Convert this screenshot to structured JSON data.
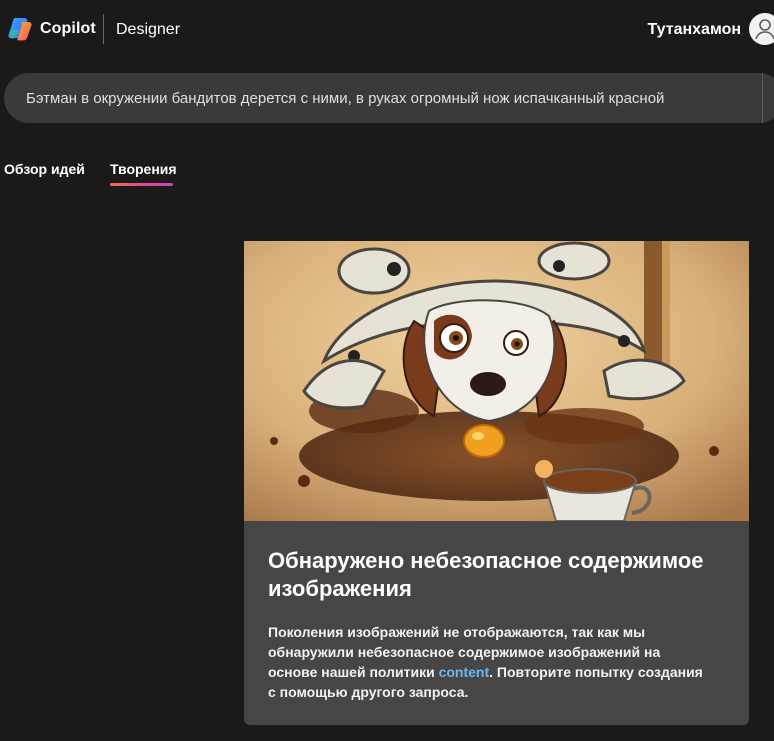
{
  "header": {
    "brand": "Copilot",
    "product": "Designer",
    "username": "Тутанхамон",
    "logo_icon": "copilot-logo-icon",
    "avatar_icon": "user-avatar-icon"
  },
  "prompt": {
    "text": "Бэтман в окружении бандитов дерется с ними, в руках огромный нож испачканный красной"
  },
  "tabs": [
    {
      "label": "Обзор идей",
      "active": false
    },
    {
      "label": "Творения",
      "active": true
    }
  ],
  "card": {
    "title": "Обнаружено небезопасное содержимое изображения",
    "body_before_link": "Поколения изображений не отображаются, так как мы обнаружили небезопасное содержимое изображений на основе нашей политики ",
    "link_text": "content",
    "body_after_link": ". Повторите попытку создания с помощью другого запроса."
  },
  "colors": {
    "background": "#1b1a19",
    "prompt_background": "#3b3a39",
    "card_background": "#484644",
    "link": "#6cb8f6",
    "tab_underline_start": "#f26e4f",
    "tab_underline_end": "#b847c7"
  }
}
